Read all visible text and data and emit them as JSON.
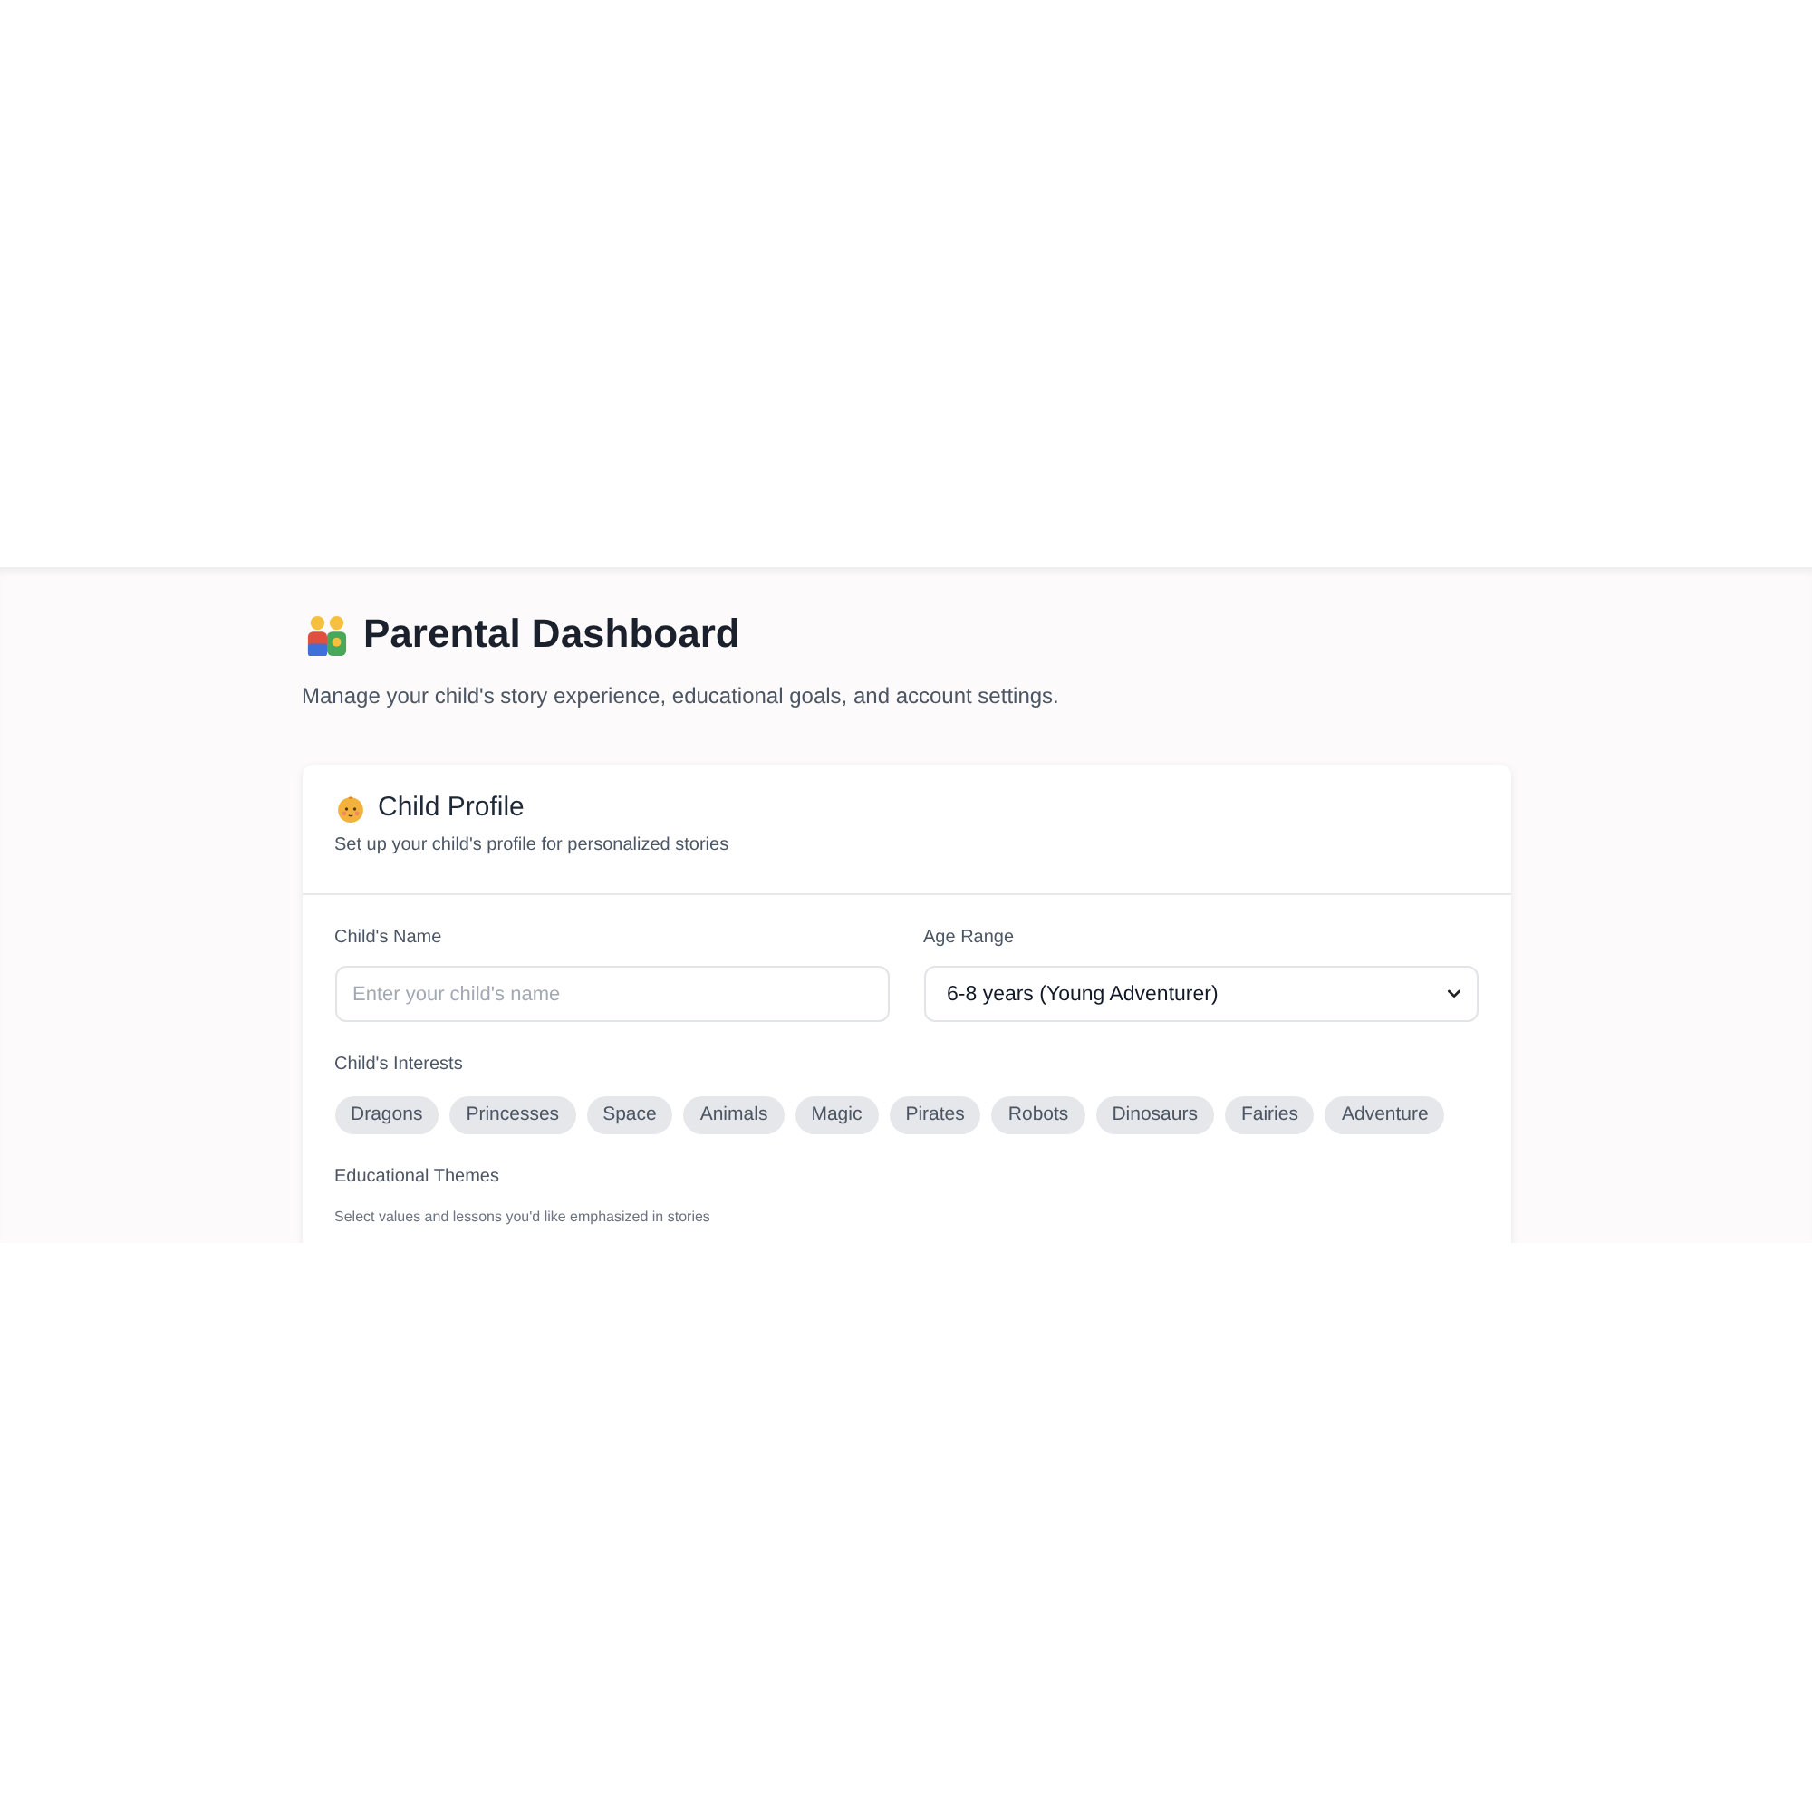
{
  "page": {
    "title": "Parental Dashboard",
    "subtitle": "Manage your child's story experience, educational goals, and account settings."
  },
  "child_profile": {
    "title": "Child Profile",
    "subtitle": "Set up your child's profile for personalized stories",
    "name_field": {
      "label": "Child's Name",
      "placeholder": "Enter your child's name"
    },
    "age_range": {
      "label": "Age Range",
      "value": "6-8 years (Young Adventurer)"
    },
    "interests": {
      "label": "Child's Interests",
      "chips": [
        {
          "label": "Dragons",
          "selected": false
        },
        {
          "label": "Princesses",
          "selected": false
        },
        {
          "label": "Space",
          "selected": false
        },
        {
          "label": "Animals",
          "selected": false
        },
        {
          "label": "Magic",
          "selected": false
        },
        {
          "label": "Pirates",
          "selected": false
        },
        {
          "label": "Robots",
          "selected": false
        },
        {
          "label": "Dinosaurs",
          "selected": false
        },
        {
          "label": "Fairies",
          "selected": false
        },
        {
          "label": "Adventure",
          "selected": false
        }
      ]
    },
    "educational_themes": {
      "label": "Educational Themes",
      "description": "Select values and lessons you'd like emphasized in stories"
    }
  }
}
